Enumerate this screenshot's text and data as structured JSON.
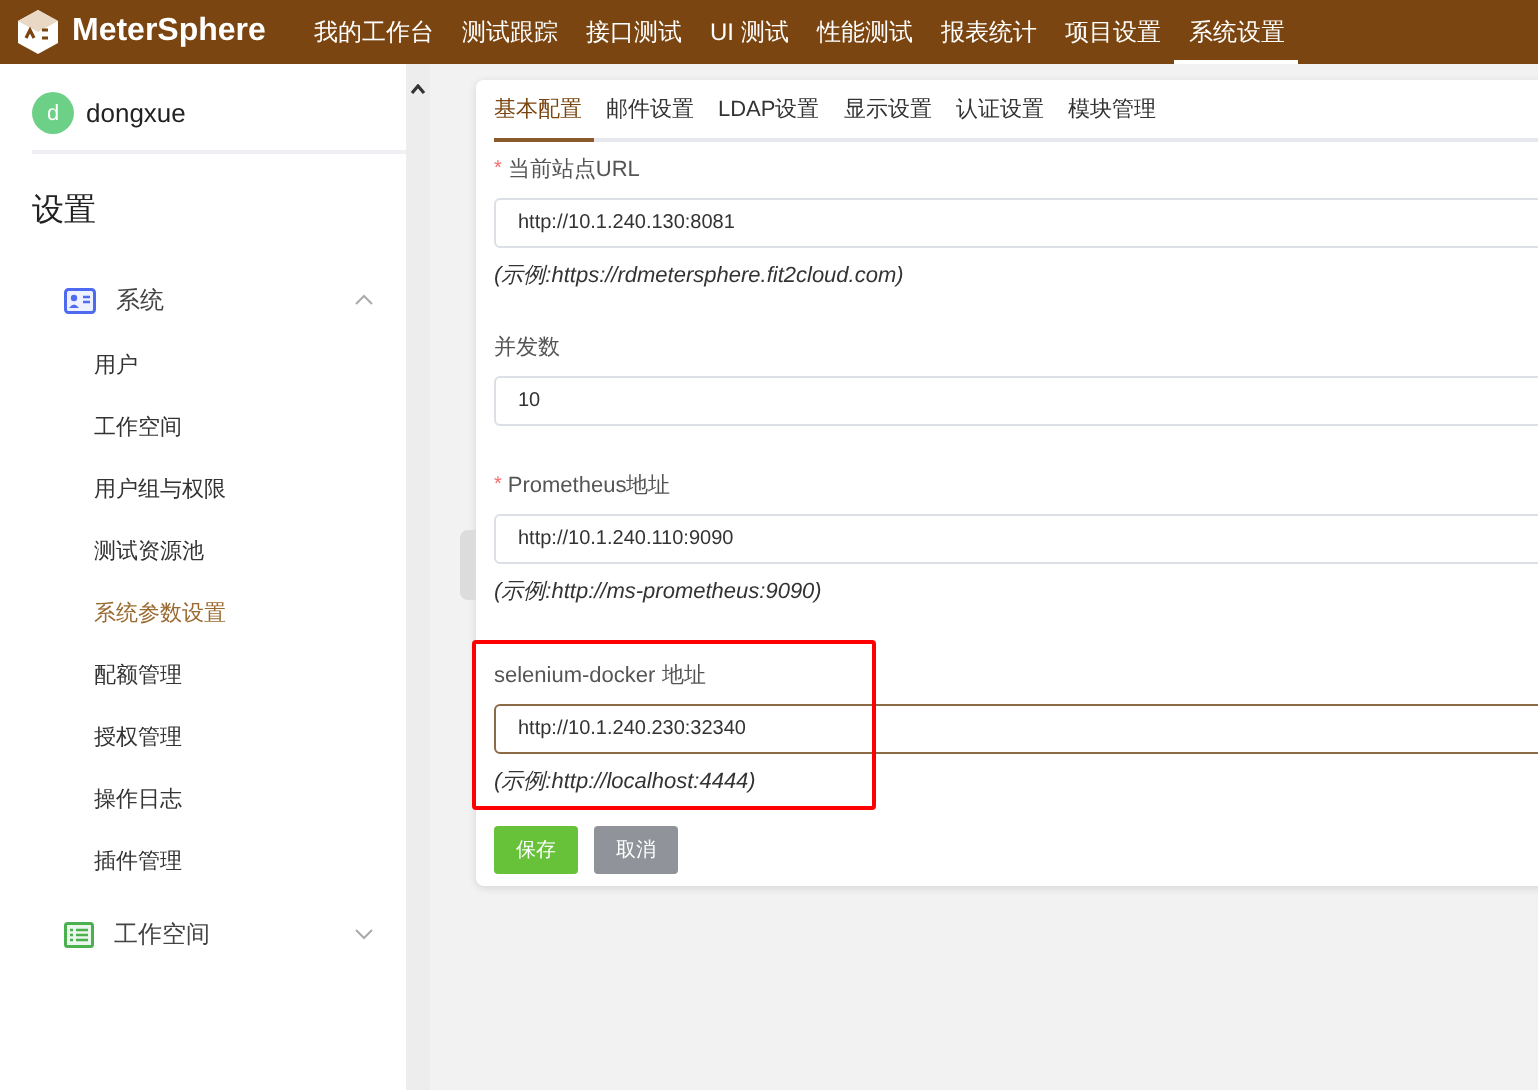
{
  "header": {
    "logo": "MeterSphere",
    "nav": [
      {
        "label": "我的工作台",
        "selected": false
      },
      {
        "label": "测试跟踪",
        "selected": false
      },
      {
        "label": "接口测试",
        "selected": false
      },
      {
        "label": "UI 测试",
        "selected": false
      },
      {
        "label": "性能测试",
        "selected": false
      },
      {
        "label": "报表统计",
        "selected": false
      },
      {
        "label": "项目设置",
        "selected": false
      },
      {
        "label": "系统设置",
        "selected": true
      }
    ]
  },
  "sidebar": {
    "user": {
      "initial": "d",
      "name": "dongxue"
    },
    "title": "设置",
    "groups": [
      {
        "kind": "system",
        "label": "系统",
        "expanded": true,
        "items": [
          {
            "label": "用户",
            "selected": false
          },
          {
            "label": "工作空间",
            "selected": false
          },
          {
            "label": "用户组与权限",
            "selected": false
          },
          {
            "label": "测试资源池",
            "selected": false
          },
          {
            "label": "系统参数设置",
            "selected": true
          },
          {
            "label": "配额管理",
            "selected": false
          },
          {
            "label": "授权管理",
            "selected": false
          },
          {
            "label": "操作日志",
            "selected": false
          },
          {
            "label": "插件管理",
            "selected": false
          }
        ]
      },
      {
        "kind": "workspace",
        "label": "工作空间",
        "expanded": false
      }
    ]
  },
  "tabs": [
    {
      "label": "基本配置",
      "selected": true
    },
    {
      "label": "邮件设置",
      "selected": false
    },
    {
      "label": "LDAP设置",
      "selected": false
    },
    {
      "label": "显示设置",
      "selected": false
    },
    {
      "label": "认证设置",
      "selected": false
    },
    {
      "label": "模块管理",
      "selected": false
    }
  ],
  "fields": [
    {
      "label": "当前站点URL",
      "required_mark": "*",
      "value": "http://10.1.240.130:8081",
      "hint": "(示例:https://rdmetersphere.fit2cloud.com)",
      "focused": false,
      "highlighted": false
    },
    {
      "label": "并发数",
      "value": "10",
      "focused": false,
      "highlighted": false
    },
    {
      "label": "Prometheus地址",
      "required_mark": "*",
      "value": "http://10.1.240.110:9090",
      "hint": "(示例:http://ms-prometheus:9090)",
      "focused": false,
      "highlighted": false
    },
    {
      "label": "selenium-docker 地址",
      "value": "http://10.1.240.230:32340",
      "hint": "(示例:http://localhost:4444)",
      "focused": true,
      "highlighted": true
    }
  ],
  "buttons": [
    {
      "kind": "primary",
      "label": "保存"
    },
    {
      "kind": "secondary",
      "label": "取消"
    }
  ]
}
